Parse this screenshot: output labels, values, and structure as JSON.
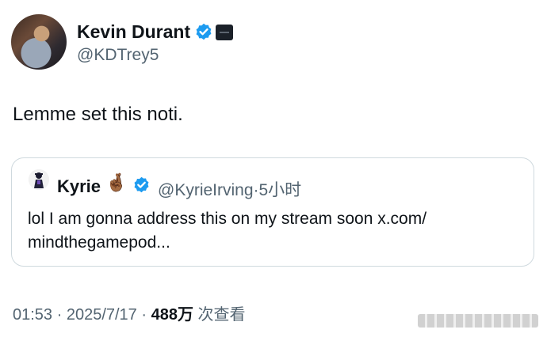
{
  "tweet": {
    "author": {
      "name": "Kevin Durant",
      "handle": "@KDTrey5",
      "verified": true
    },
    "text": "Lemme set this noti.",
    "quoted": {
      "name": "Kyrie",
      "emoji": "🤞🏾",
      "handle_time": "@KyrieIrving·5小时",
      "text": "lol I am gonna address this on my stream soon x.com/ mindthegamepod..."
    },
    "meta": {
      "time_date": "01:53 · 2025/7/17 · ",
      "views_count": "488万",
      "views_label": " 次查看"
    }
  },
  "colors": {
    "verified_blue": "#1d9bf0",
    "secondary_text": "#536471",
    "primary_text": "#0f1419",
    "border": "#cfd9de"
  },
  "icons": [
    "verified-badge-icon",
    "organization-badge-icon",
    "crossed-fingers-emoji"
  ]
}
